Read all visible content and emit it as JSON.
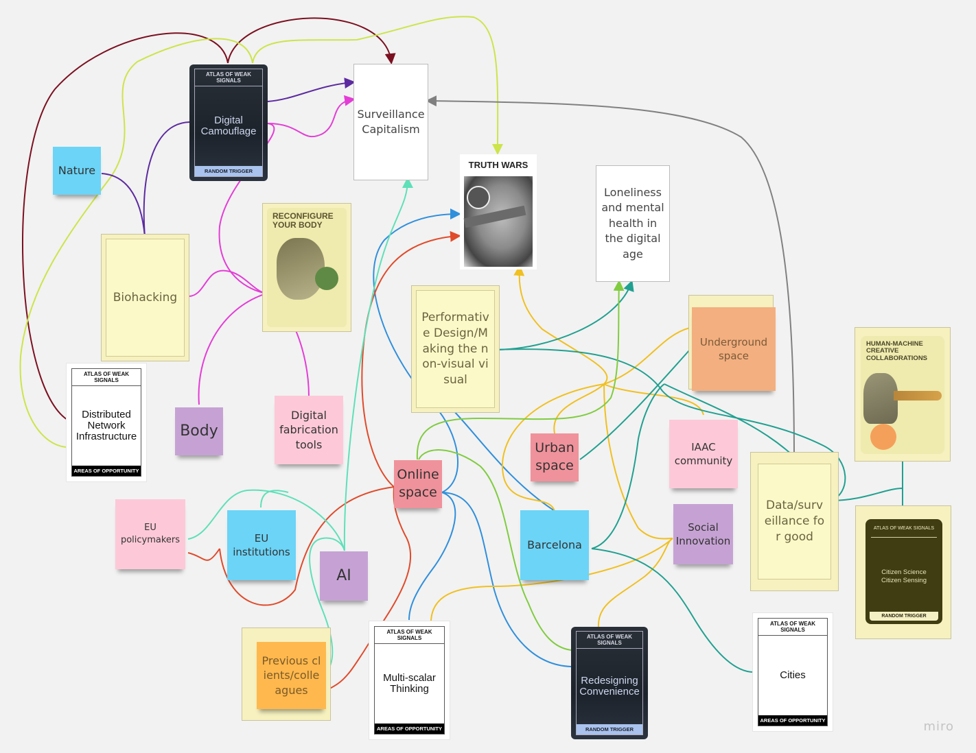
{
  "app": {
    "watermark": "miro"
  },
  "colors": {
    "sticky_blue": "#6bd4f7",
    "sticky_pink": "#fdc9d8",
    "sticky_purple": "#c6a2d4",
    "sticky_red": "#f0929b",
    "sticky_orange": "#ffb84d",
    "sticky_salmon": "#f3af7f",
    "frame_yellow": "#f6f1bf",
    "link_maroon": "#7b1020",
    "link_lime": "#cde44a",
    "link_purple": "#5c2aa0",
    "link_magenta": "#e43cd6",
    "link_teal": "#20a090",
    "link_mint": "#5ee0b8",
    "link_blue": "#2f8fdc",
    "link_red": "#e04a2a",
    "link_yellow": "#f0c020",
    "link_green": "#80cc40",
    "link_grey": "#808080"
  },
  "cards": {
    "digital_camouflage": {
      "header": "ATLAS OF WEAK SIGNALS",
      "title": "Digital Camouflage",
      "footer": "RANDOM TRIGGER"
    },
    "redesigning_convenience": {
      "header": "ATLAS OF WEAK SIGNALS",
      "title": "Redesigning Convenience",
      "footer": "RANDOM TRIGGER"
    },
    "citizen_science": {
      "header": "ATLAS OF WEAK SIGNALS",
      "title": "Citizen Science Citizen Sensing",
      "footer": "RANDOM TRIGGER"
    },
    "distributed_network": {
      "header": "ATLAS OF WEAK SIGNALS",
      "title": "Distributed Network Infrastructure",
      "footer": "AREAS OF OPPORTUNITY"
    },
    "multi_scalar": {
      "header": "ATLAS OF WEAK SIGNALS",
      "title": "Multi-scalar Thinking",
      "footer": "AREAS OF OPPORTUNITY"
    },
    "cities": {
      "header": "ATLAS OF WEAK SIGNALS",
      "title": "Cities",
      "footer": "AREAS OF OPPORTUNITY"
    },
    "truth_wars": {
      "title": "TRUTH WARS"
    },
    "reconfigure_body": {
      "title": "RECONFIGURE YOUR BODY"
    },
    "human_machine": {
      "title": "HUMAN-MACHINE CREATIVE COLLABORATIONS"
    }
  },
  "notes": {
    "surveillance_capitalism": "Surveillance Capitalism",
    "loneliness": "Loneliness and mental health in the digital age",
    "nature": "Nature",
    "biohacking": "Biohacking",
    "performative_design": "Performative Design/Making the non-visual visual",
    "underground_space": "Underground space",
    "data_surveillance_good": "Data/surveillance for good",
    "body": "Body",
    "digital_fabrication": "Digital fabrication tools",
    "urban_space": "Urban space",
    "iaac_community": "IAAC community",
    "online_space": "Online space",
    "eu_policymakers": "EU policymakers",
    "eu_institutions": "EU institutions",
    "ai": "AI",
    "barcelona": "Barcelona",
    "social_innovation": "Social Innovation",
    "previous_clients": "Previous clients/colleagues"
  }
}
